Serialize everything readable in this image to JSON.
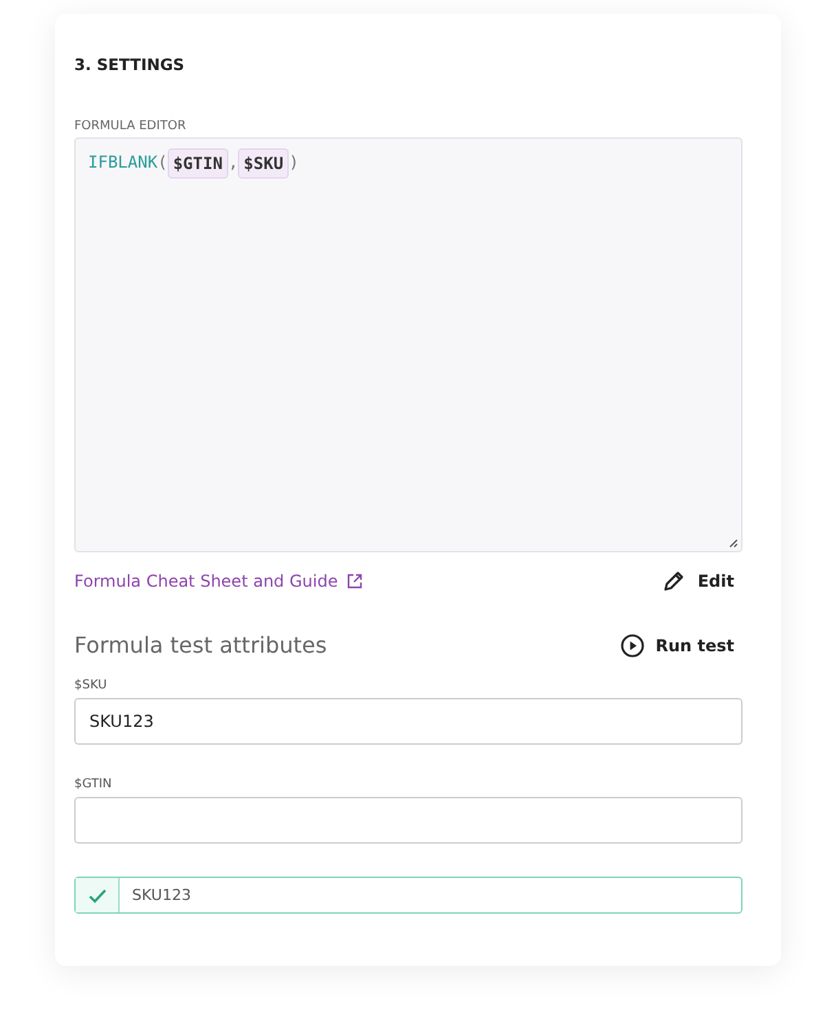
{
  "section_title": "3. SETTINGS",
  "formula_editor": {
    "label": "FORMULA EDITOR",
    "tokens": [
      {
        "kind": "function",
        "text": "IFBLANK"
      },
      {
        "kind": "punct",
        "text": "("
      },
      {
        "kind": "attribute",
        "text": "$GTIN"
      },
      {
        "kind": "punct",
        "text": ","
      },
      {
        "kind": "attribute",
        "text": "$SKU"
      },
      {
        "kind": "punct",
        "text": ")"
      }
    ]
  },
  "guide_link": "Formula Cheat Sheet and Guide",
  "edit_button": "Edit",
  "test_heading": "Formula test attributes",
  "run_button": "Run test",
  "fields": [
    {
      "label": "$SKU",
      "value": "SKU123"
    },
    {
      "label": "$GTIN"
    }
  ],
  "result": {
    "passed": true,
    "value": "SKU123"
  }
}
